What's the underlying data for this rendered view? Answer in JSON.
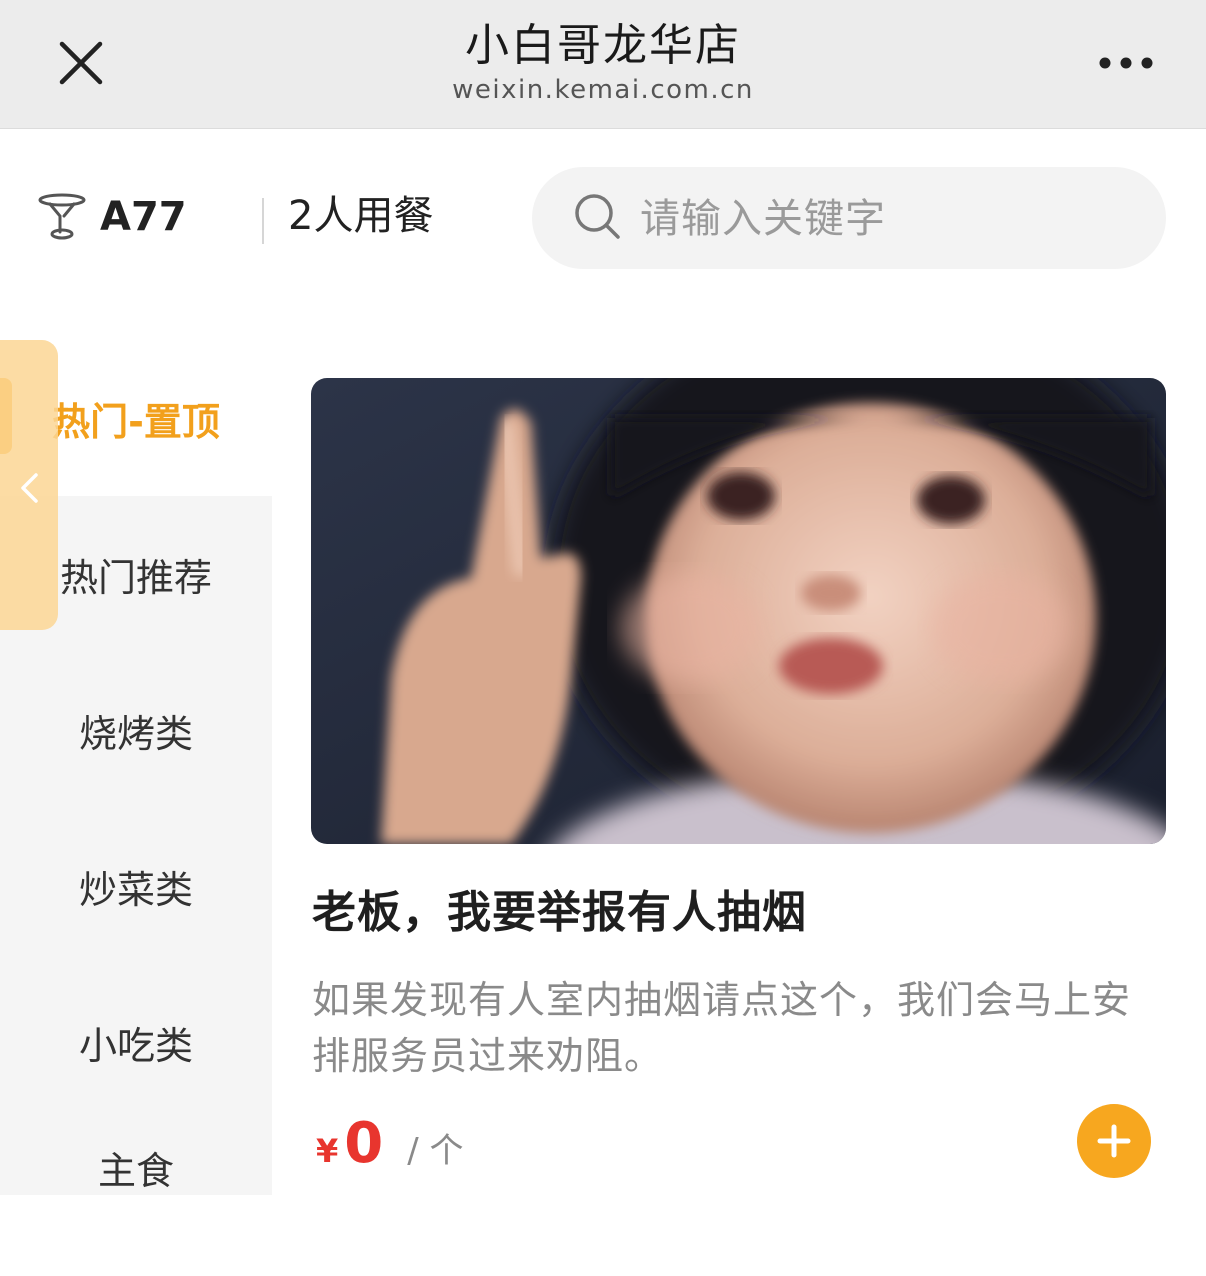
{
  "navbar": {
    "title": "小白哥龙华店",
    "domain": "weixin.kemai.com.cn"
  },
  "table": {
    "number": "A77",
    "guests": "2人用餐"
  },
  "search": {
    "placeholder": "请输入关键字"
  },
  "categories": [
    {
      "label": "热门-置顶",
      "active": true
    },
    {
      "label": "热门推荐",
      "active": false
    },
    {
      "label": "烧烤类",
      "active": false
    },
    {
      "label": "炒菜类",
      "active": false
    },
    {
      "label": "小吃类",
      "active": false
    },
    {
      "label": "主食",
      "active": false
    }
  ],
  "item": {
    "title": "老板，我要举报有人抽烟",
    "description": "如果发现有人室内抽烟请点这个，我们会马上安排服务员过来劝阻。",
    "currency": "¥",
    "price": "0",
    "unit": "/ 个"
  },
  "colors": {
    "accent": "#f7a71f",
    "price": "#e8352e",
    "navbar_bg": "#ececec"
  },
  "icons": {
    "close": "close-icon",
    "more": "more-dots-icon",
    "table": "table-icon",
    "search": "search-icon",
    "collapse": "chevron-left-icon",
    "add": "plus-icon"
  }
}
